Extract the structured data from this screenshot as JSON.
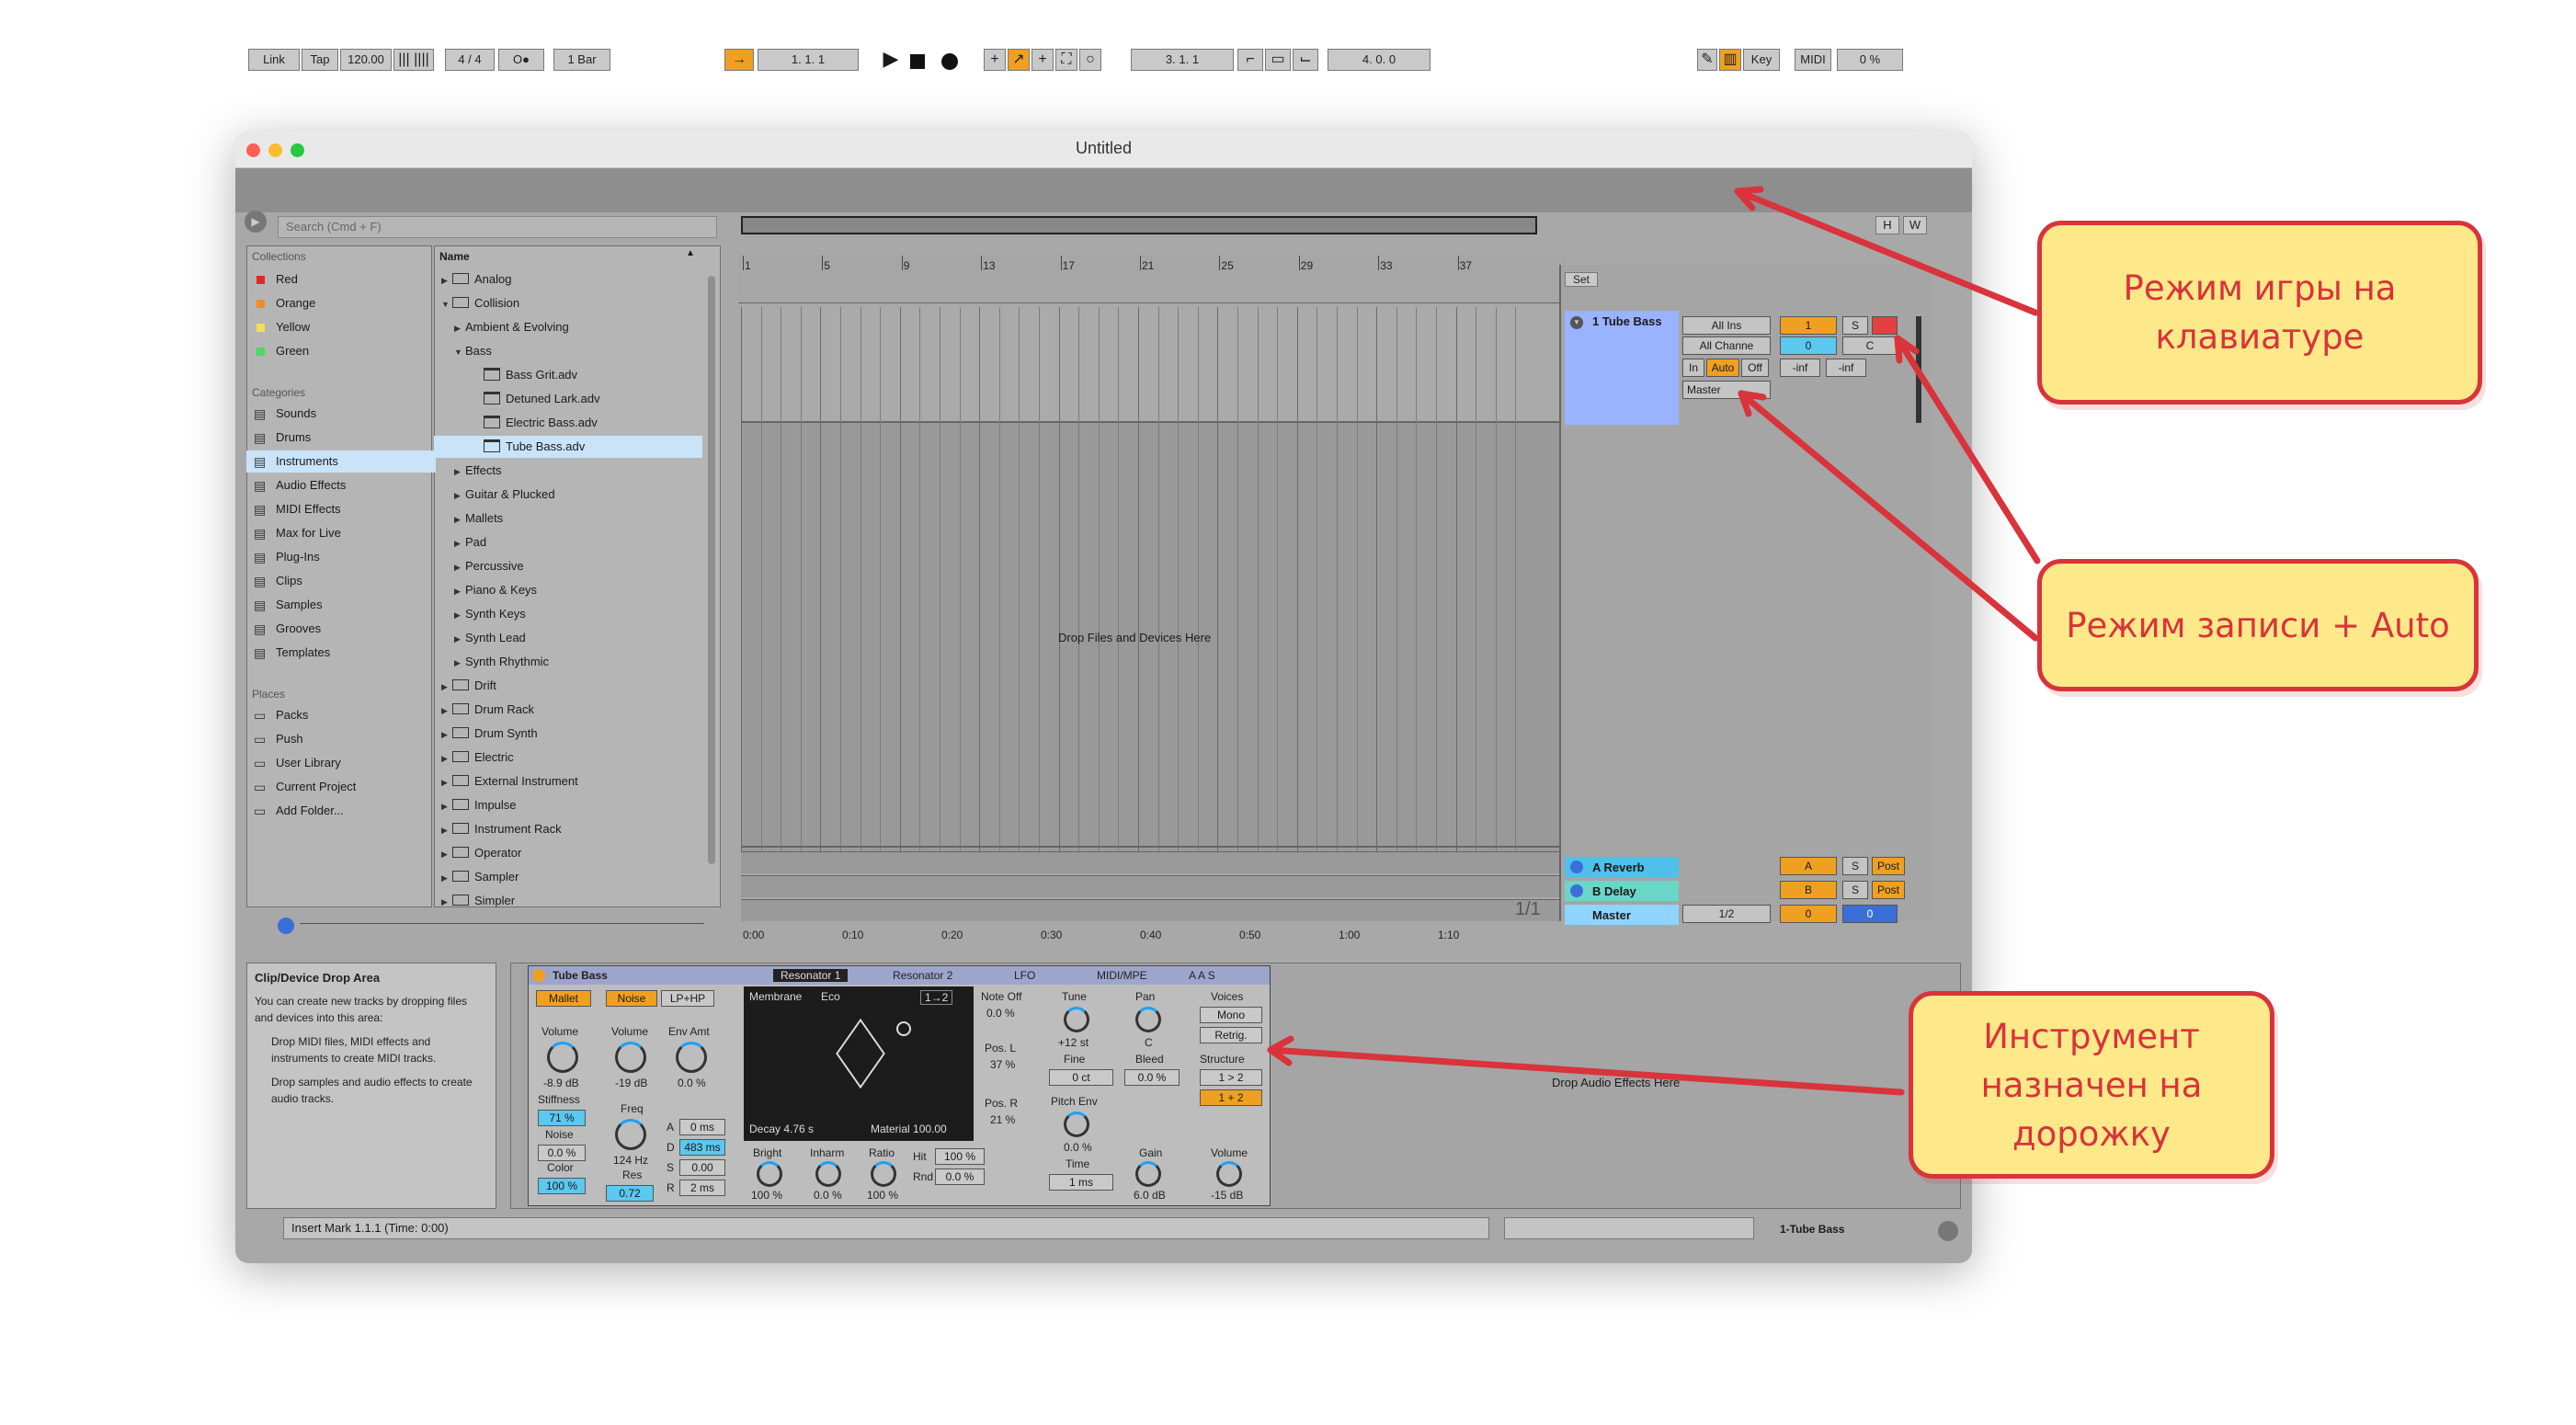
{
  "window": {
    "title": "Untitled"
  },
  "toolbar": {
    "link": "Link",
    "tap": "Tap",
    "tempo": "120.00",
    "time_sig": "4 / 4",
    "metronome": "O●",
    "quantize": "1 Bar",
    "position": "1.   1.   1",
    "loop_start": "3.   1.   1",
    "loop_length": "4.   0.   0",
    "key": "Key",
    "midi": "MIDI",
    "cpu": "0 %"
  },
  "browser": {
    "search_placeholder": "Search (Cmd + F)",
    "collections_label": "Collections",
    "collections": [
      {
        "label": "Red",
        "color": "#e02a2a"
      },
      {
        "label": "Orange",
        "color": "#f08c1e"
      },
      {
        "label": "Yellow",
        "color": "#f5e050"
      },
      {
        "label": "Green",
        "color": "#4cd964"
      }
    ],
    "categories_label": "Categories",
    "categories": [
      {
        "label": "Sounds",
        "icon": "note-icon"
      },
      {
        "label": "Drums",
        "icon": "grid-icon"
      },
      {
        "label": "Instruments",
        "icon": "clock-icon"
      },
      {
        "label": "Audio Effects",
        "icon": "wave-icon"
      },
      {
        "label": "MIDI Effects",
        "icon": "sliders-icon"
      },
      {
        "label": "Max for Live",
        "icon": "link-icon"
      },
      {
        "label": "Plug-Ins",
        "icon": "plug-icon"
      },
      {
        "label": "Clips",
        "icon": "clip-icon"
      },
      {
        "label": "Samples",
        "icon": "wave-icon"
      },
      {
        "label": "Grooves",
        "icon": "groove-icon"
      },
      {
        "label": "Templates",
        "icon": "template-icon"
      }
    ],
    "places_label": "Places",
    "places": [
      {
        "label": "Packs"
      },
      {
        "label": "Push"
      },
      {
        "label": "User Library"
      },
      {
        "label": "Current Project"
      },
      {
        "label": "Add Folder..."
      }
    ],
    "name_header": "Name",
    "tree": [
      {
        "label": "Analog",
        "level": 0,
        "type": "folder",
        "arrow": "▶"
      },
      {
        "label": "Collision",
        "level": 0,
        "type": "folder",
        "arrow": "▼"
      },
      {
        "label": "Ambient & Evolving",
        "level": 1,
        "type": "text",
        "arrow": "▶"
      },
      {
        "label": "Bass",
        "level": 1,
        "type": "text",
        "arrow": "▼"
      },
      {
        "label": "Bass Grit.adv",
        "level": 2,
        "type": "file",
        "arrow": ""
      },
      {
        "label": "Detuned Lark.adv",
        "level": 2,
        "type": "file",
        "arrow": ""
      },
      {
        "label": "Electric Bass.adv",
        "level": 2,
        "type": "file",
        "arrow": ""
      },
      {
        "label": "Tube Bass.adv",
        "level": 2,
        "type": "file",
        "arrow": ""
      },
      {
        "label": "Effects",
        "level": 1,
        "type": "text",
        "arrow": "▶"
      },
      {
        "label": "Guitar & Plucked",
        "level": 1,
        "type": "text",
        "arrow": "▶"
      },
      {
        "label": "Mallets",
        "level": 1,
        "type": "text",
        "arrow": "▶"
      },
      {
        "label": "Pad",
        "level": 1,
        "type": "text",
        "arrow": "▶"
      },
      {
        "label": "Percussive",
        "level": 1,
        "type": "text",
        "arrow": "▶"
      },
      {
        "label": "Piano & Keys",
        "level": 1,
        "type": "text",
        "arrow": "▶"
      },
      {
        "label": "Synth Keys",
        "level": 1,
        "type": "text",
        "arrow": "▶"
      },
      {
        "label": "Synth Lead",
        "level": 1,
        "type": "text",
        "arrow": "▶"
      },
      {
        "label": "Synth Rhythmic",
        "level": 1,
        "type": "text",
        "arrow": "▶"
      },
      {
        "label": "Drift",
        "level": 0,
        "type": "folder",
        "arrow": "▶"
      },
      {
        "label": "Drum Rack",
        "level": 0,
        "type": "folder",
        "arrow": "▶"
      },
      {
        "label": "Drum Synth",
        "level": 0,
        "type": "folder",
        "arrow": "▶"
      },
      {
        "label": "Electric",
        "level": 0,
        "type": "folder",
        "arrow": "▶"
      },
      {
        "label": "External Instrument",
        "level": 0,
        "type": "folder",
        "arrow": "▶"
      },
      {
        "label": "Impulse",
        "level": 0,
        "type": "folder",
        "arrow": "▶"
      },
      {
        "label": "Instrument Rack",
        "level": 0,
        "type": "folder",
        "arrow": "▶"
      },
      {
        "label": "Operator",
        "level": 0,
        "type": "folder",
        "arrow": "▶"
      },
      {
        "label": "Sampler",
        "level": 0,
        "type": "folder",
        "arrow": "▶"
      },
      {
        "label": "Simpler",
        "level": 0,
        "type": "folder",
        "arrow": "▶"
      }
    ]
  },
  "arrangement": {
    "bar_ticks": [
      "1",
      "5",
      "9",
      "13",
      "17",
      "21",
      "25",
      "29",
      "33",
      "37"
    ],
    "time_ticks": [
      "0:00",
      "0:10",
      "0:20",
      "0:30",
      "0:40",
      "0:50",
      "1:00",
      "1:10"
    ],
    "drop_text": "Drop Files and Devices Here",
    "counter": "1/1",
    "set_label": "Set",
    "buttons": {
      "h": "H",
      "w": "W"
    }
  },
  "tracks": {
    "main": {
      "name": "1 Tube Bass",
      "input": "All Ins",
      "channel": "All Channe",
      "monitor_in": "In",
      "monitor_auto": "Auto",
      "monitor_off": "Off",
      "output": "Master",
      "number": "1",
      "solo": "S",
      "volume": "0",
      "pan": "C",
      "peak_l": "-inf",
      "peak_r": "-inf"
    },
    "returns": [
      {
        "name": "A Reverb",
        "letter": "A",
        "solo": "S",
        "post": "Post",
        "color": "#4fc0e8"
      },
      {
        "name": "B Delay",
        "letter": "B",
        "solo": "S",
        "post": "Post",
        "color": "#6ad6c8"
      }
    ],
    "master": {
      "name": "Master",
      "out": "1/2",
      "volume": "0",
      "pan": "0"
    }
  },
  "detail": {
    "info_title": "Clip/Device Drop Area",
    "info_text": "You can create new tracks by dropping files and devices into this area:",
    "info_bullets": [
      "Drop MIDI files, MIDI effects and instruments to create MIDI tracks.",
      "Drop samples and audio effects to create audio tracks."
    ],
    "drop_audio": "Drop Audio Effects Here",
    "status": "Insert Mark 1.1.1 (Time: 0:00)",
    "track_label": "1-Tube Bass"
  },
  "device": {
    "name": "Tube Bass",
    "tabs": [
      "Resonator 1",
      "Resonator 2",
      "LFO",
      "MIDI/MPE"
    ],
    "corner": "A A S",
    "mallet": {
      "label": "Mallet",
      "volume_label": "Volume",
      "volume": "-8.9 dB",
      "stiffness_label": "Stiffness",
      "stiffness": "71 %",
      "noise_label": "Noise",
      "noise": "0.0 %",
      "color_label": "Color",
      "color": "100 %"
    },
    "noise": {
      "label": "Noise",
      "filter": "LP+HP",
      "volume_label": "Volume",
      "volume": "-19 dB",
      "env_label": "Env Amt",
      "env": "0.0 %",
      "freq_label": "Freq",
      "freq": "124 Hz",
      "res_label": "Res",
      "res": "0.72",
      "a_label": "A",
      "a": "0 ms",
      "d_label": "D",
      "d": "483 ms",
      "s_label": "S",
      "s": "0.00",
      "r_label": "R",
      "r": "2 ms"
    },
    "resonator": {
      "type": "Membrane",
      "quality": "Eco",
      "ratio_mode": "1→2",
      "decay": "Decay 4.76 s",
      "material": "Material 100.00",
      "bright_label": "Bright",
      "bright": "100 %",
      "inharm_label": "Inharm",
      "inharm": "0.0 %",
      "ratio_label": "Ratio",
      "ratio": "100 %",
      "hit_label": "Hit",
      "hit": "100 %",
      "rnd_label": "Rnd",
      "rnd": "0.0 %",
      "noteoff_label": "Note Off",
      "noteoff": "0.0 %",
      "posl_label": "Pos. L",
      "posl": "37 %",
      "posr_label": "Pos. R",
      "posr": "21 %"
    },
    "tune": {
      "label": "Tune",
      "value": "+12 st",
      "fine_label": "Fine",
      "fine": "0 ct",
      "pitchenv_label": "Pitch Env",
      "pitchenv": "0.0 %",
      "time_label": "Time",
      "time": "1 ms"
    },
    "pan": {
      "label": "Pan",
      "value": "C",
      "bleed_label": "Bleed",
      "bleed": "0.0 %",
      "gain_label": "Gain",
      "gain": "6.0 dB"
    },
    "voices": {
      "label": "Voices",
      "mode": "Mono",
      "retrig": "Retrig.",
      "structure_label": "Structure",
      "s1": "1 > 2",
      "s2": "1 + 2",
      "volume_label": "Volume",
      "volume": "-15 dB"
    }
  },
  "annotations": [
    {
      "text": "Режим игры на клавиатуре"
    },
    {
      "text": "Режим записи + Auto"
    },
    {
      "text": "Инструмент назначен на дорожку"
    }
  ],
  "colors": {
    "accent": "#f0a020",
    "blue": "#5bc8f0",
    "annotation_red": "#d9333b",
    "annotation_fill": "#fde98a",
    "track_blue": "#9ab3ff"
  }
}
